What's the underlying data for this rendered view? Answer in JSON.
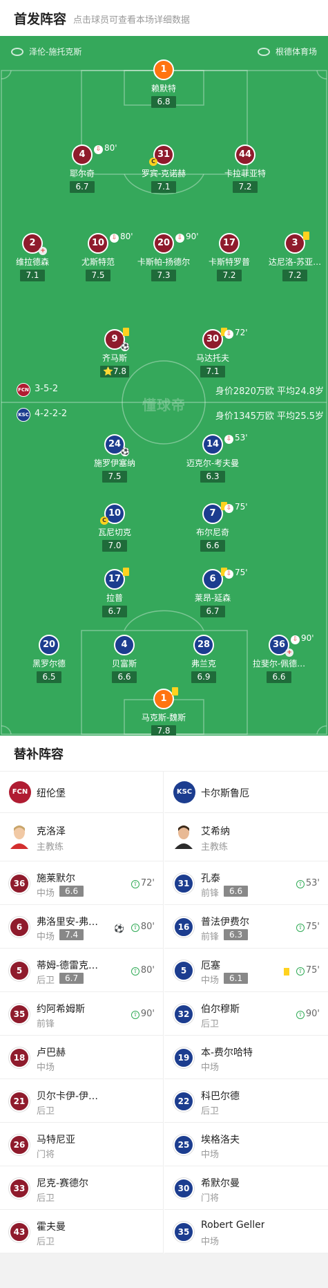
{
  "header": {
    "title": "首发阵容",
    "subtitle": "点击球员可查看本场详细数据"
  },
  "pitch": {
    "home_venue": "泽伦-施托克斯",
    "away_venue": "根德体育场",
    "watermark": "懂球帝",
    "home_formation": "3-5-2",
    "home_stats": "身价2820万欧  平均24.8岁",
    "away_formation": "4-2-2-2",
    "away_stats": "身价1345万欧  平均25.5岁",
    "home_badge": "FCN",
    "away_badge": "KSC"
  },
  "home_players": [
    {
      "num": "1",
      "name": "赖默特",
      "rating": "6.8"
    },
    {
      "num": "4",
      "name": "耶尔奇",
      "rating": "6.7",
      "sub": "80'"
    },
    {
      "num": "31",
      "name": "罗宾-克诺赫",
      "rating": "7.1"
    },
    {
      "num": "44",
      "name": "卡拉菲亚特",
      "rating": "7.2"
    },
    {
      "num": "2",
      "name": "维拉德森",
      "rating": "7.1"
    },
    {
      "num": "10",
      "name": "尤斯特范",
      "rating": "7.5",
      "sub": "80'"
    },
    {
      "num": "20",
      "name": "卡斯帕-扬德尔",
      "rating": "7.3",
      "sub": "90'"
    },
    {
      "num": "17",
      "name": "卡斯特罗普",
      "rating": "7.2"
    },
    {
      "num": "3",
      "name": "达尼洛-苏亚…",
      "rating": "7.2"
    },
    {
      "num": "9",
      "name": "齐马斯",
      "rating": "7.8"
    },
    {
      "num": "30",
      "name": "马达托夫",
      "rating": "7.1",
      "sub": "72'"
    }
  ],
  "away_players": [
    {
      "num": "24",
      "name": "施罗伊塞纳",
      "rating": "7.5"
    },
    {
      "num": "14",
      "name": "迈克尔-考夫曼",
      "rating": "6.3",
      "sub": "53'"
    },
    {
      "num": "10",
      "name": "瓦尼切克",
      "rating": "7.0"
    },
    {
      "num": "7",
      "name": "布尔尼奇",
      "rating": "6.6",
      "sub": "75'"
    },
    {
      "num": "17",
      "name": "拉普",
      "rating": "6.7"
    },
    {
      "num": "6",
      "name": "莱昂-延森",
      "rating": "6.7",
      "sub": "75'"
    },
    {
      "num": "20",
      "name": "黑罗尔德",
      "rating": "6.5"
    },
    {
      "num": "4",
      "name": "贝富斯",
      "rating": "6.6"
    },
    {
      "num": "28",
      "name": "弗兰克",
      "rating": "6.9"
    },
    {
      "num": "36",
      "name": "拉斐尔-佩德…",
      "rating": "6.6",
      "sub": "90'"
    },
    {
      "num": "1",
      "name": "马克斯-魏斯",
      "rating": "7.8"
    }
  ],
  "subs": {
    "title": "替补阵容",
    "home_team": "纽伦堡",
    "away_team": "卡尔斯鲁厄",
    "home_coach": {
      "name": "克洛泽",
      "role": "主教练"
    },
    "away_coach": {
      "name": "艾希纳",
      "role": "主教练"
    },
    "home": [
      {
        "num": "36",
        "name": "施莱默尔",
        "pos": "中场",
        "rating": "6.6",
        "in": "72'"
      },
      {
        "num": "6",
        "name": "弗洛里安-弗…",
        "pos": "中场",
        "rating": "7.4",
        "in": "80'"
      },
      {
        "num": "5",
        "name": "蒂姆-德雷克…",
        "pos": "后卫",
        "rating": "6.7",
        "in": "80'"
      },
      {
        "num": "35",
        "name": "约阿希姆斯",
        "pos": "前锋",
        "rating": "",
        "in": "90'"
      },
      {
        "num": "18",
        "name": "卢巴赫",
        "pos": "中场",
        "rating": "",
        "in": ""
      },
      {
        "num": "21",
        "name": "贝尔卡伊-伊…",
        "pos": "后卫",
        "rating": "",
        "in": ""
      },
      {
        "num": "26",
        "name": "马特尼亚",
        "pos": "门将",
        "rating": "",
        "in": ""
      },
      {
        "num": "33",
        "name": "尼克-赛德尔",
        "pos": "后卫",
        "rating": "",
        "in": ""
      },
      {
        "num": "43",
        "name": "霍夫曼",
        "pos": "后卫",
        "rating": "",
        "in": ""
      }
    ],
    "away": [
      {
        "num": "31",
        "name": "孔泰",
        "pos": "前锋",
        "rating": "6.6",
        "in": "53'"
      },
      {
        "num": "16",
        "name": "普法伊费尔",
        "pos": "前锋",
        "rating": "6.3",
        "in": "75'"
      },
      {
        "num": "5",
        "name": "厄塞",
        "pos": "中场",
        "rating": "6.1",
        "in": "75'"
      },
      {
        "num": "32",
        "name": "伯尔穆斯",
        "pos": "后卫",
        "rating": "",
        "in": "90'"
      },
      {
        "num": "19",
        "name": "本-费尔哈特",
        "pos": "中场",
        "rating": "",
        "in": ""
      },
      {
        "num": "22",
        "name": "科巴尔德",
        "pos": "后卫",
        "rating": "",
        "in": ""
      },
      {
        "num": "25",
        "name": "埃格洛夫",
        "pos": "中场",
        "rating": "",
        "in": ""
      },
      {
        "num": "30",
        "name": "希默尔曼",
        "pos": "门将",
        "rating": "",
        "in": ""
      },
      {
        "num": "35",
        "name": "Robert Geller",
        "pos": "中场",
        "rating": "",
        "in": ""
      }
    ]
  },
  "colors": {
    "pitch": "#35a85b",
    "home": "#8f1b2c",
    "away": "#1c3d8f",
    "gk": "#ff7410",
    "card": "#ffd21f"
  },
  "icons": [
    "field-icon",
    "stadium-icon",
    "sub-out-icon",
    "sub-in-icon",
    "yellow-card-icon",
    "goal-ball-icon",
    "captain-icon",
    "injury-icon"
  ]
}
